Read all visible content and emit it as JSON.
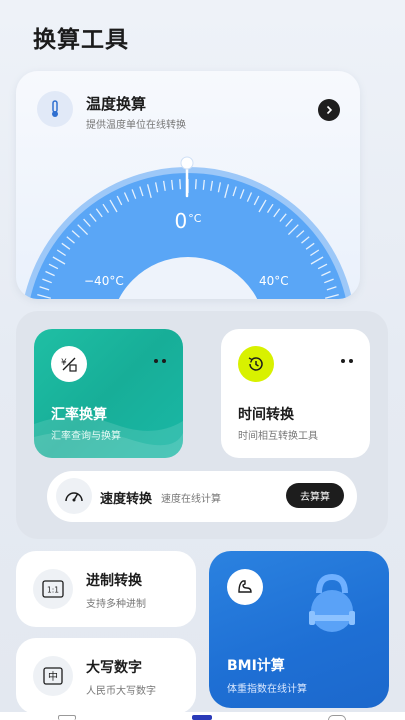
{
  "page": {
    "title": "换算工具"
  },
  "temperature": {
    "title": "温度换算",
    "subtitle": "提供温度单位在线转换",
    "value": "0",
    "unit": "°C",
    "min_label": "−40°C",
    "max_label": "40°C",
    "gauge_colors": {
      "outer": "#4f9cf5",
      "inner": "#2f7fe8"
    }
  },
  "exchange": {
    "title": "汇率换算",
    "subtitle": "汇率查询与换算",
    "icon": "currency-icon",
    "accent": "#1fbfa4"
  },
  "time": {
    "title": "时间转换",
    "subtitle": "时间相互转换工具",
    "icon": "clock-icon",
    "accent": "#d8f100"
  },
  "speed": {
    "title": "速度转换",
    "subtitle": "速度在线计算",
    "button": "去算算",
    "icon": "speedometer-icon"
  },
  "base": {
    "title": "进制转换",
    "subtitle": "支持多种进制",
    "icon_text": "1:1"
  },
  "uppercase": {
    "title": "大写数字",
    "subtitle": "人民币大写数字",
    "icon_text": "中"
  },
  "bmi": {
    "title": "BMI计算",
    "subtitle": "体重指数在线计算",
    "icon": "arm-muscle-icon",
    "accent": "#2b82e0"
  }
}
